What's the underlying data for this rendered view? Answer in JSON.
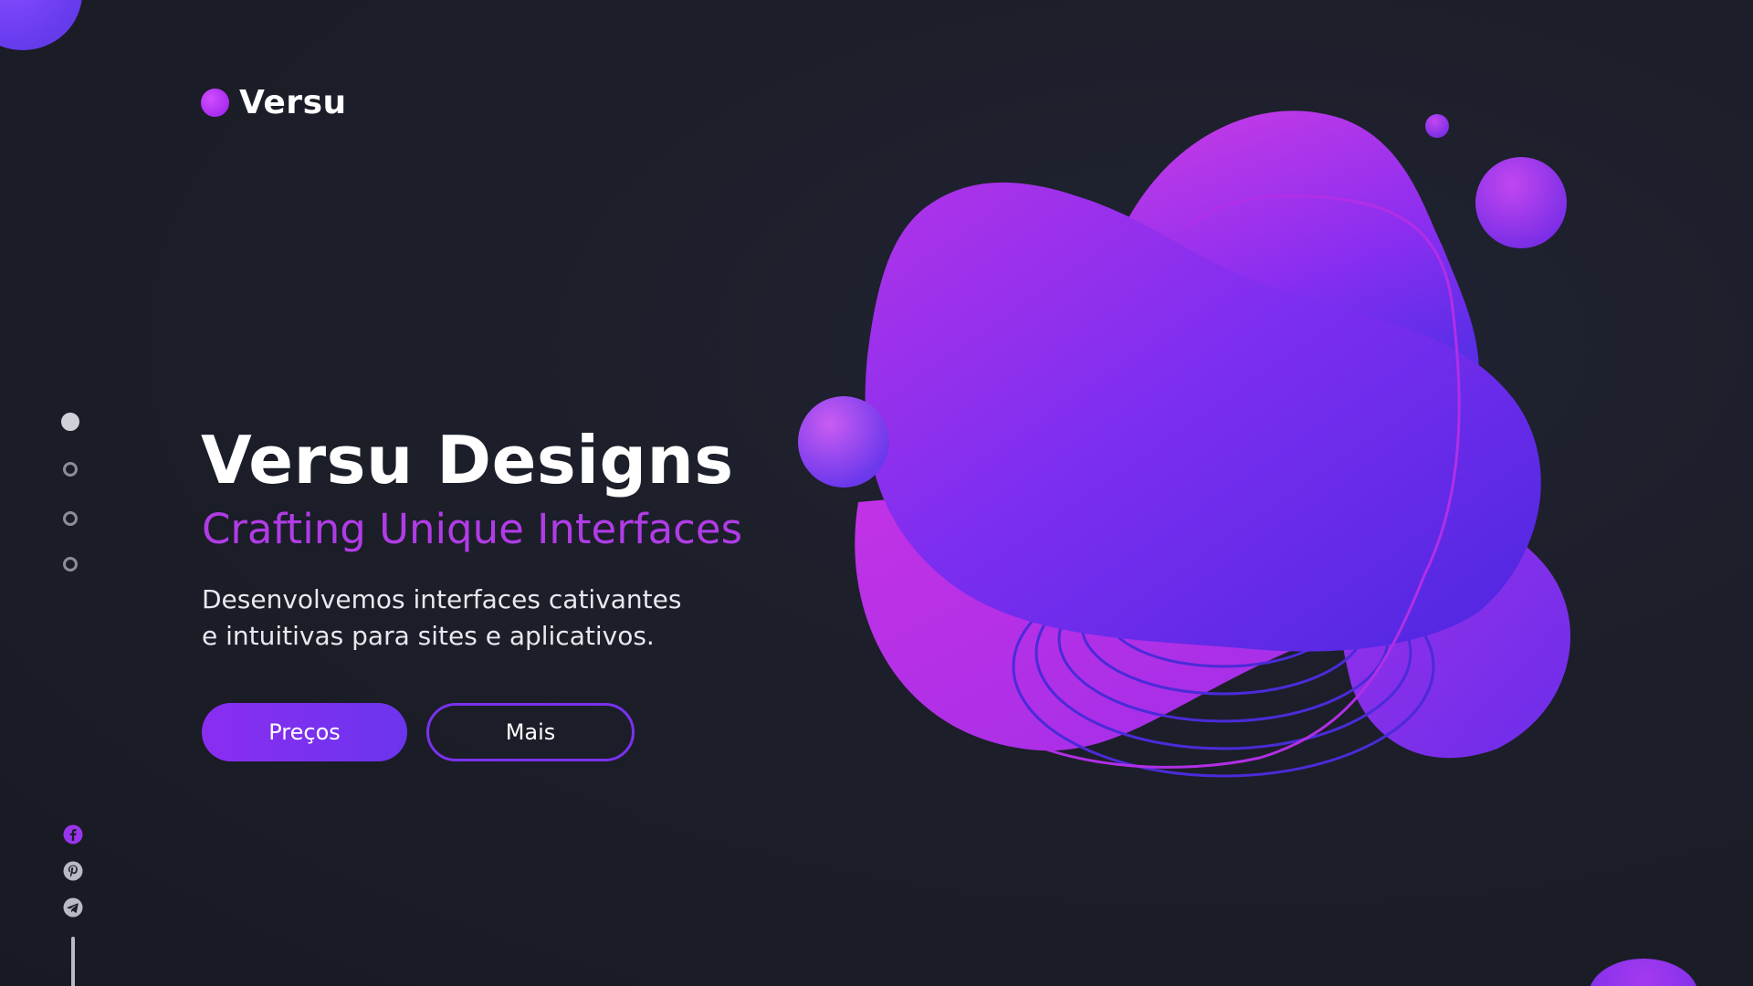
{
  "brand": {
    "name": "Versu",
    "accent": "#b03ce6",
    "primary": "#7a32ee",
    "background": "#1c1e29"
  },
  "slider": {
    "dots": [
      {
        "active": true
      },
      {
        "active": false
      },
      {
        "active": false
      },
      {
        "active": false
      }
    ]
  },
  "hero": {
    "title": "Versu Designs",
    "subtitle": "Crafting Unique Interfaces",
    "description_line1": "Desenvolvemos interfaces cativantes",
    "description_line2": "e intuitivas para sites e aplicativos."
  },
  "buttons": {
    "primary_label": "Preços",
    "secondary_label": "Mais"
  },
  "social": {
    "icons": [
      "facebook-icon",
      "pinterest-icon",
      "telegram-icon"
    ],
    "facebook_color": "#9a35ee",
    "other_color": "#b9bac4"
  }
}
